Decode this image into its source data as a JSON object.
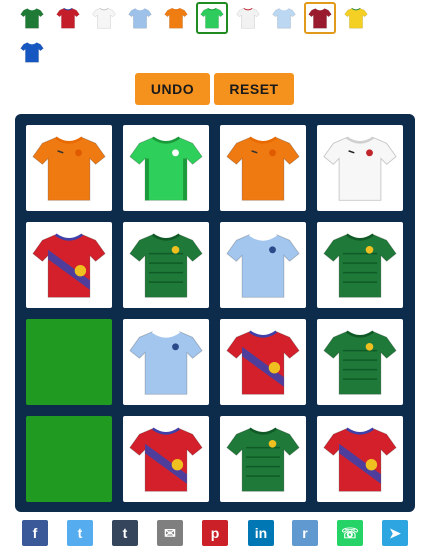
{
  "controls": {
    "undo_label": "UNDO",
    "reset_label": "RESET"
  },
  "palette": [
    {
      "name": "green-shirt",
      "body": "#1e7a34",
      "trim": "#ffffff"
    },
    {
      "name": "red-shirt",
      "body": "#c41e2a",
      "trim": "#2a3d9c"
    },
    {
      "name": "white-shirt",
      "body": "#f6f6f6",
      "trim": "#c8c8c8"
    },
    {
      "name": "light-blue-shirt",
      "body": "#9ec1ea",
      "trim": "#ffffff"
    },
    {
      "name": "orange-shirt",
      "body": "#f07d12",
      "trim": "#e06a00"
    },
    {
      "name": "bright-green-shirt",
      "body": "#2ecc5c",
      "trim": "#1a9a3a",
      "selected": "green"
    },
    {
      "name": "germany-shirt",
      "body": "#f2f2f2",
      "trim": "#c0262c"
    },
    {
      "name": "striped-shirt",
      "body": "#bcd7f2",
      "trim": "#ffffff"
    },
    {
      "name": "maroon-shirt",
      "body": "#9a1b2e",
      "trim": "#ffffff",
      "selected": "orange"
    },
    {
      "name": "yellow-shirt",
      "body": "#f4d024",
      "trim": "#2f8a3a"
    },
    {
      "name": "blue-shirt",
      "body": "#1657c2",
      "trim": "#ffffff"
    }
  ],
  "board": [
    [
      {
        "kit": "orange"
      },
      {
        "kit": "bright-green"
      },
      {
        "kit": "orange"
      },
      {
        "kit": "white"
      }
    ],
    [
      {
        "kit": "red-sash"
      },
      {
        "kit": "dark-green"
      },
      {
        "kit": "light-blue"
      },
      {
        "kit": "dark-green"
      }
    ],
    [
      {
        "kit": "blank"
      },
      {
        "kit": "light-blue"
      },
      {
        "kit": "red-sash"
      },
      {
        "kit": "dark-green"
      }
    ],
    [
      {
        "kit": "blank"
      },
      {
        "kit": "red-sash"
      },
      {
        "kit": "dark-green"
      },
      {
        "kit": "red-sash"
      }
    ]
  ],
  "kits": {
    "orange": {
      "body": "#f07a12",
      "trim": "#e86a00"
    },
    "bright-green": {
      "body": "#2fcf5c",
      "trim": "#1a9a3a"
    },
    "white": {
      "body": "#f7f7f7",
      "trim": "#d0d0d0"
    },
    "red-sash": {
      "body": "#d4202b",
      "trim": "#4040a8"
    },
    "dark-green": {
      "body": "#1f7a3a",
      "trim": "#0f5a26"
    },
    "light-blue": {
      "body": "#a3c6ee",
      "trim": "#ffffff"
    }
  },
  "share": [
    {
      "name": "facebook",
      "glyph": "f",
      "color": "#3b5998"
    },
    {
      "name": "twitter",
      "glyph": "t",
      "color": "#55acee"
    },
    {
      "name": "tumblr",
      "glyph": "t",
      "color": "#35465c"
    },
    {
      "name": "email",
      "glyph": "✉",
      "color": "#7f7f7f"
    },
    {
      "name": "pinterest",
      "glyph": "p",
      "color": "#cb2027"
    },
    {
      "name": "linkedin",
      "glyph": "in",
      "color": "#0077b5"
    },
    {
      "name": "reddit",
      "glyph": "r",
      "color": "#5f99cf"
    },
    {
      "name": "whatsapp",
      "glyph": "☏",
      "color": "#25d366"
    },
    {
      "name": "telegram",
      "glyph": "➤",
      "color": "#2ca5e0"
    }
  ]
}
